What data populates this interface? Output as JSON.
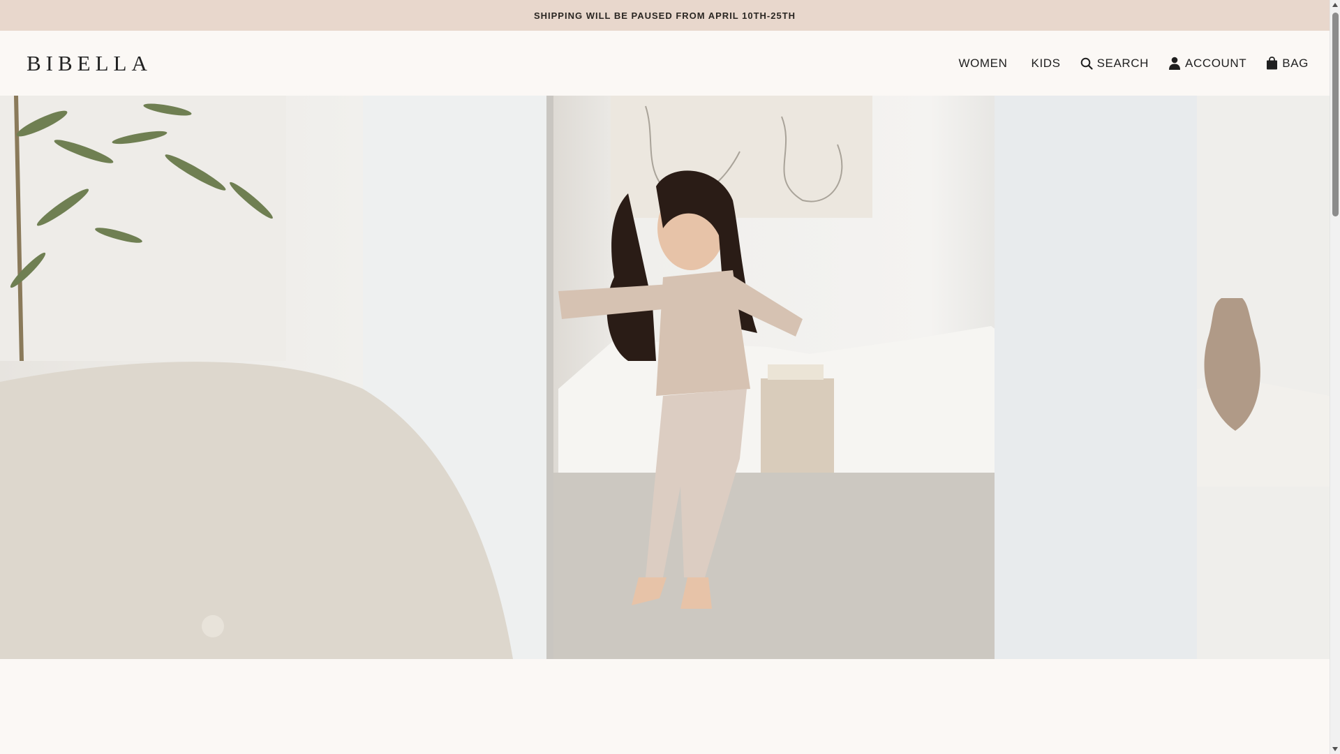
{
  "announcement": {
    "text": "SHIPPING WILL BE PAUSED FROM APRIL 10TH-25TH"
  },
  "header": {
    "logo": "BIBELLA",
    "nav": {
      "women": "WOMEN",
      "kids": "KIDS",
      "search": "SEARCH",
      "account": "ACCOUNT",
      "bag": "BAG"
    }
  },
  "hero": {
    "image": "girl-dancing-in-pajamas-living-room"
  },
  "colors": {
    "announcement_bg": "#e8d7cc",
    "page_bg": "#fbf8f5",
    "text": "#1f1f1f"
  },
  "icons": {
    "search": "search-icon",
    "account": "user-icon",
    "bag": "bag-icon"
  }
}
